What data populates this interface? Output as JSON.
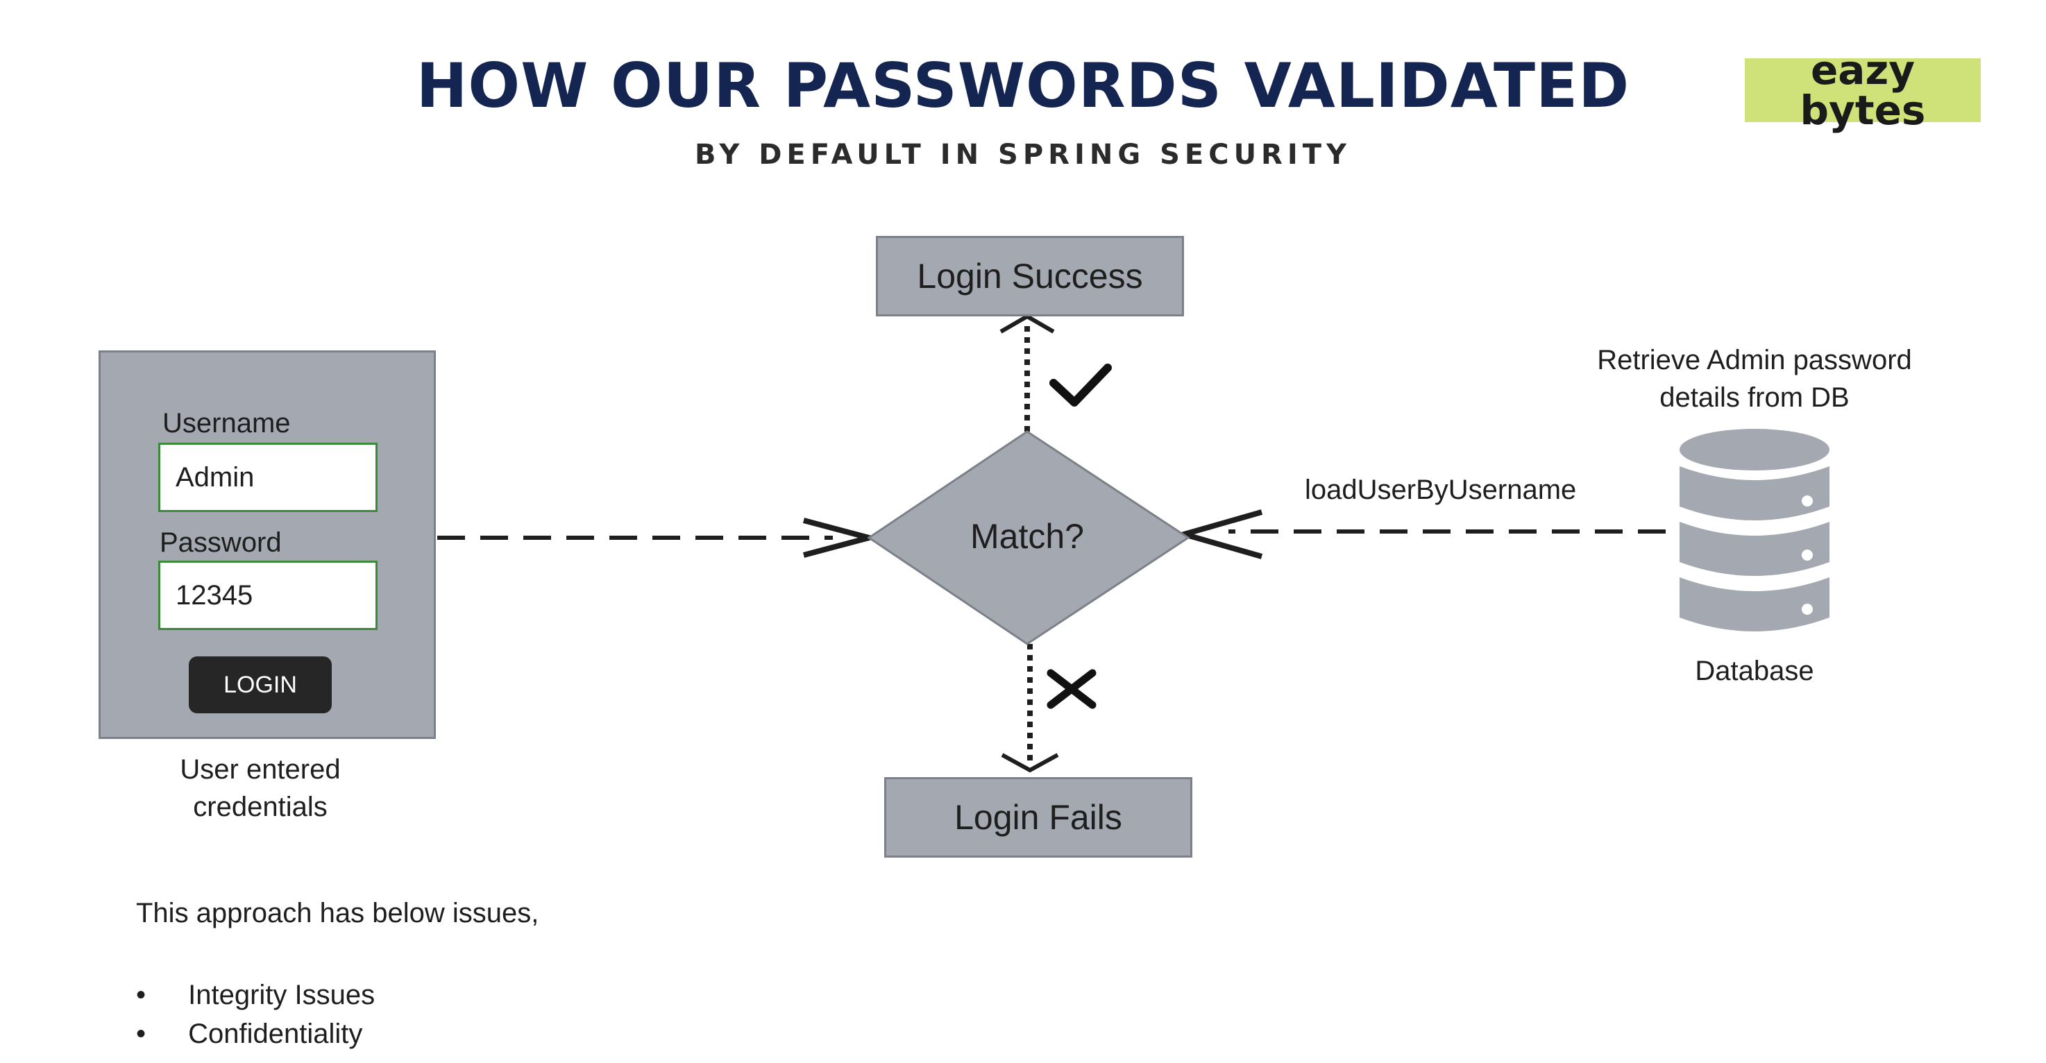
{
  "header": {
    "title": "HOW OUR PASSWORDS VALIDATED",
    "subtitle": "BY DEFAULT IN SPRING SECURITY",
    "logo_line1": "eazy",
    "logo_line2": "bytes",
    "logo_color": "#cfe27a"
  },
  "login_panel": {
    "username_label": "Username",
    "username_value": "Admin",
    "password_label": "Password",
    "password_value": "12345",
    "button_label": "LOGIN",
    "caption_line1": "User entered",
    "caption_line2": "credentials"
  },
  "flow": {
    "decision_label": "Match?",
    "success_label": "Login Success",
    "fail_label": "Login Fails",
    "success_mark": "check-icon",
    "fail_mark": "cross-icon",
    "edge_label": "loadUserByUsername"
  },
  "database": {
    "caption_top_line1": "Retrieve Admin password",
    "caption_top_line2": "details from DB",
    "label": "Database",
    "icon": "database-icon"
  },
  "notes": {
    "intro": "This approach has below issues,",
    "items": [
      "Integrity Issues",
      "Confidentiality"
    ]
  },
  "colors": {
    "title": "#142552",
    "box_fill": "#a4a8b0",
    "field_border": "#3a8a3a"
  }
}
